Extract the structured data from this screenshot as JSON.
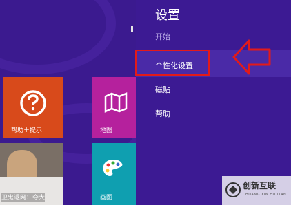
{
  "start": {
    "tiles": [
      {
        "label": "帮助＋提示"
      },
      {
        "label": "地图"
      },
      {
        "label": "卫鬼退网：夺大"
      },
      {
        "label": "画图"
      }
    ]
  },
  "charm": {
    "title": "设置",
    "section": "开始",
    "items": [
      {
        "label": "个性化设置"
      },
      {
        "label": "磁贴"
      },
      {
        "label": "帮助"
      }
    ]
  },
  "watermark": {
    "name": "创新互联",
    "tagline": "CHUANG XIN HU LIAN"
  },
  "colors": {
    "accent": "#3c1a93",
    "highlight": "#e31a1a"
  }
}
